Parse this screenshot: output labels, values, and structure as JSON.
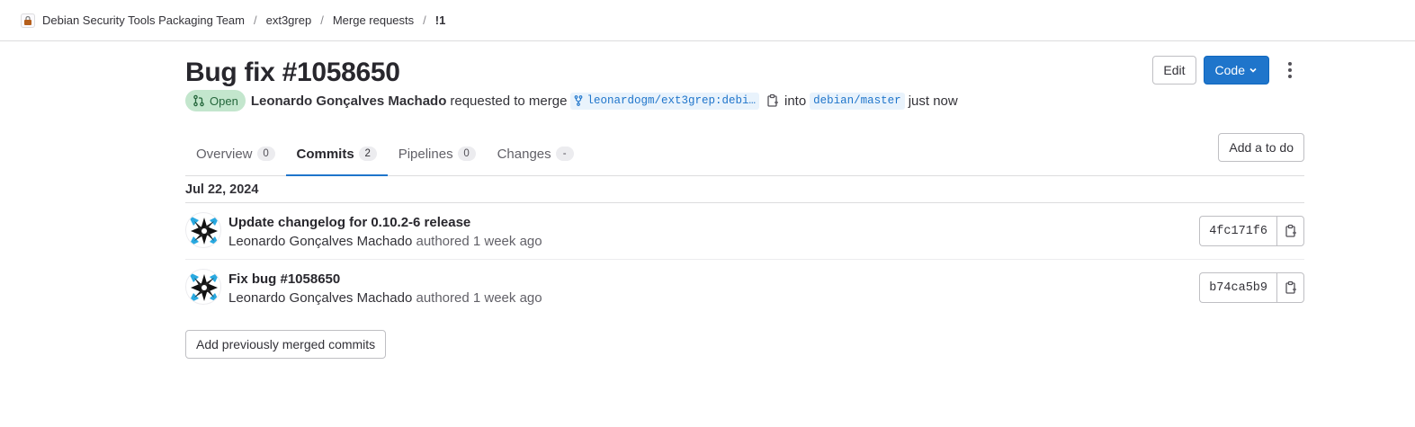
{
  "breadcrumb": {
    "group": "Debian Security Tools Packaging Team",
    "project": "ext3grep",
    "section": "Merge requests",
    "current": "!1"
  },
  "mr": {
    "title": "Bug fix #1058650",
    "status": "Open",
    "author": "Leonardo Gonçalves Machado",
    "requested_text": "requested to merge",
    "source_branch": "leonardogm/ext3grep:debi…",
    "into_text": "into",
    "target_branch": "debian/master",
    "time": "just now"
  },
  "actions": {
    "edit_label": "Edit",
    "code_label": "Code"
  },
  "tabs": [
    {
      "label": "Overview",
      "count": "0"
    },
    {
      "label": "Commits",
      "count": "2"
    },
    {
      "label": "Pipelines",
      "count": "0"
    },
    {
      "label": "Changes",
      "count": "-"
    }
  ],
  "active_tab": "Commits",
  "todo_label": "Add a to do",
  "commits": {
    "date": "Jul 22, 2024",
    "items": [
      {
        "title": "Update changelog for 0.10.2-6 release",
        "author": "Leonardo Gonçalves Machado",
        "authored": "authored",
        "time": "1 week ago",
        "sha": "4fc171f6"
      },
      {
        "title": "Fix bug #1058650",
        "author": "Leonardo Gonçalves Machado",
        "authored": "authored",
        "time": "1 week ago",
        "sha": "b74ca5b9"
      }
    ]
  },
  "prev_commits_label": "Add previously merged commits",
  "colors": {
    "primary": "#1f75cb",
    "open_badge_bg": "#c3e6cd",
    "open_badge_text": "#24663b",
    "branch_bg": "#e9f3fc"
  },
  "icons": {
    "merge_request": "merge-request-icon",
    "branch": "fork-icon",
    "copy": "copy-to-clipboard-icon",
    "more": "ellipsis-v-icon",
    "caret": "chevron-down-icon"
  }
}
